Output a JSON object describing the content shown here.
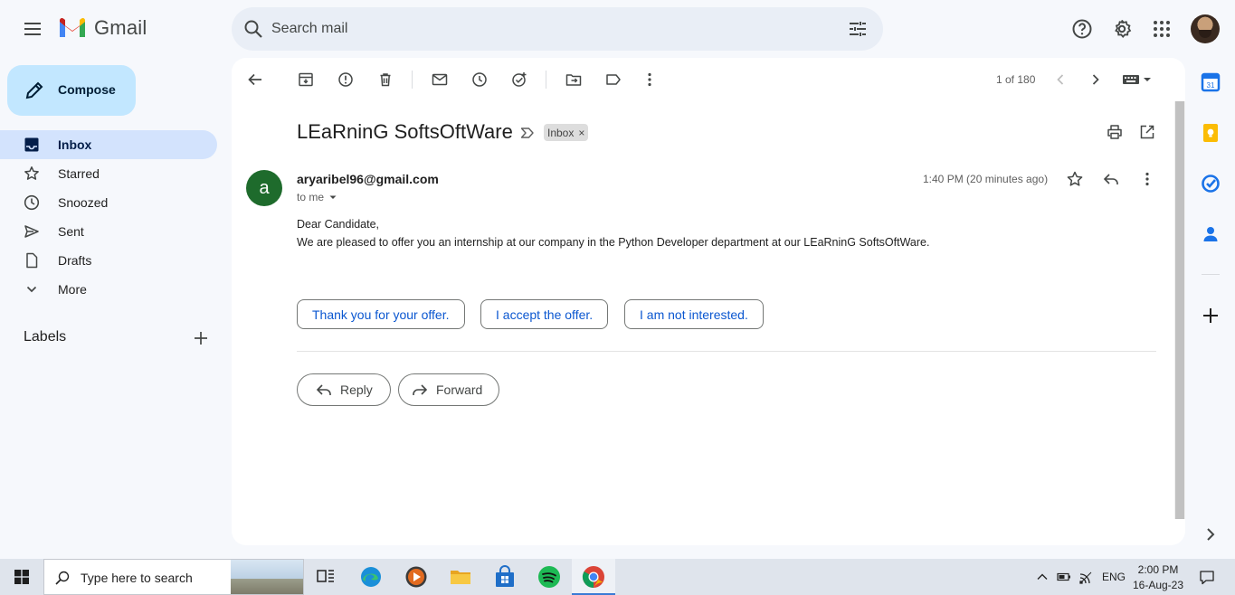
{
  "app": {
    "name": "Gmail"
  },
  "search": {
    "placeholder": "Search mail"
  },
  "sidebar": {
    "compose_label": "Compose",
    "items": [
      {
        "label": "Inbox",
        "icon": "inbox-icon",
        "active": true
      },
      {
        "label": "Starred",
        "icon": "star-icon"
      },
      {
        "label": "Snoozed",
        "icon": "clock-icon"
      },
      {
        "label": "Sent",
        "icon": "send-icon"
      },
      {
        "label": "Drafts",
        "icon": "draft-icon"
      },
      {
        "label": "More",
        "icon": "chevron-down-icon"
      }
    ],
    "labels_title": "Labels"
  },
  "toolbar": {
    "pager": "1 of 180"
  },
  "email": {
    "subject": "LEaRninG SoftsOftWare",
    "label_chip": "Inbox",
    "label_chip_close": "×",
    "sender_initial": "a",
    "sender": "aryaribel96@gmail.com",
    "to": "to me",
    "time": "1:40 PM (20 minutes ago)",
    "body_lines": [
      "Dear Candidate,",
      "We are pleased to offer you an internship at our company in the Python Developer department at our LEaRninG SoftsOftWare."
    ],
    "smart_replies": [
      "Thank you for your offer.",
      "I accept the offer.",
      "I am not interested."
    ],
    "reply_label": "Reply",
    "forward_label": "Forward"
  },
  "taskbar": {
    "search_placeholder": "Type here to search",
    "language": "ENG",
    "time": "2:00 PM",
    "date": "16-Aug-23"
  },
  "colors": {
    "background": "#f6f8fc",
    "compose": "#c2e7ff",
    "active_nav": "#d3e3fd",
    "accent": "#0b57d0",
    "sender_avatar": "#1e6b2c"
  }
}
